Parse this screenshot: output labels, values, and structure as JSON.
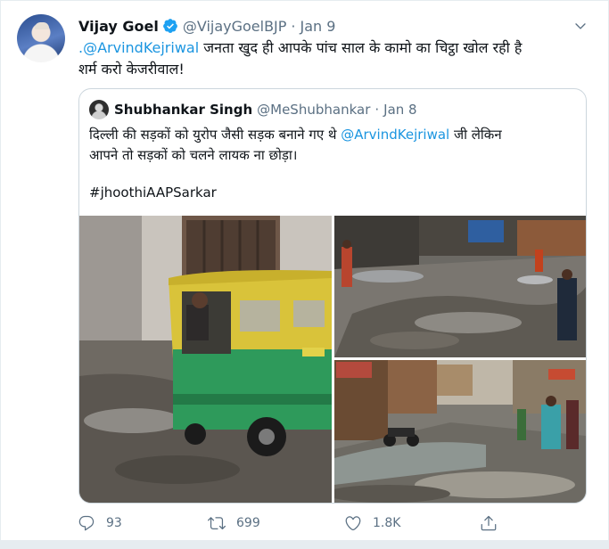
{
  "tweet": {
    "author_name": "Vijay Goel",
    "author_handle": "@VijayGoelBJP",
    "separator": "·",
    "date": "Jan 9",
    "verified": true,
    "text_mention": ".@ArvindKejriwal",
    "text_line1_rest": " जनता खुद ही आपके पांच साल के कामो का चिट्ठा खोल रही है",
    "text_line2": "शर्म करो केजरीवाल!"
  },
  "quoted_tweet": {
    "author_name": "Shubhankar Singh",
    "author_handle": "@MeShubhankar",
    "separator": "·",
    "date": "Jan 8",
    "text_line1_pre": "दिल्ली की सड़कों को युरोप जैसी सड़क बनाने गए थे ",
    "text_mention": "@ArvindKejriwal",
    "text_line1_post": " जी लेकिन",
    "text_line2": "आपने तो सड़कों को चलने लायक ना छोड़ा।",
    "hashtag": "#jhoothiAAPSarkar",
    "photos": [
      "auto-rickshaw-waterlogged-road-photo",
      "garbage-filled-street-photo",
      "flooded-market-street-photo"
    ]
  },
  "actions": {
    "reply_count": "93",
    "retweet_count": "699",
    "like_count": "1.8K"
  },
  "icons": [
    "verified-badge-icon",
    "chevron-down-icon",
    "reply-icon",
    "retweet-icon",
    "like-icon",
    "share-icon"
  ],
  "colors": {
    "link": "#1b95e0",
    "secondary_text": "#5b7083",
    "border": "#ccd6dd",
    "verified": "#1da1f2"
  }
}
